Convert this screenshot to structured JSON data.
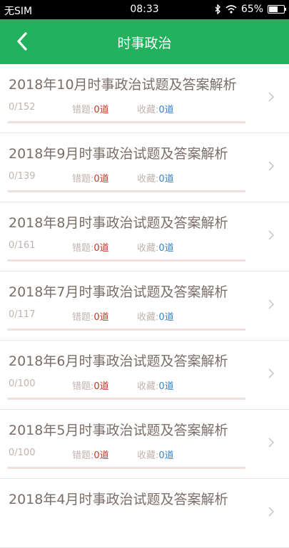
{
  "status": {
    "carrier": "无SIM",
    "time": "08:33",
    "battery": "65%",
    "battery_level": 0.65
  },
  "header": {
    "title": "时事政治"
  },
  "labels": {
    "wrong": "错题:",
    "fav": "收藏:"
  },
  "items": [
    {
      "title": "2018年10月时事政治试题及答案解析",
      "progress": "0/152",
      "wrong": "0道",
      "fav": "0道"
    },
    {
      "title": "2018年9月时事政治试题及答案解析",
      "progress": "0/139",
      "wrong": "0道",
      "fav": "0道"
    },
    {
      "title": "2018年8月时事政治试题及答案解析",
      "progress": "0/161",
      "wrong": "0道",
      "fav": "0道"
    },
    {
      "title": "2018年7月时事政治试题及答案解析",
      "progress": "0/117",
      "wrong": "0道",
      "fav": "0道"
    },
    {
      "title": "2018年6月时事政治试题及答案解析",
      "progress": "0/100",
      "wrong": "0道",
      "fav": "0道"
    },
    {
      "title": "2018年5月时事政治试题及答案解析",
      "progress": "0/100",
      "wrong": "0道",
      "fav": "0道"
    },
    {
      "title": "2018年4月时事政治试题及答案解析",
      "progress": "",
      "wrong": "",
      "fav": ""
    }
  ]
}
